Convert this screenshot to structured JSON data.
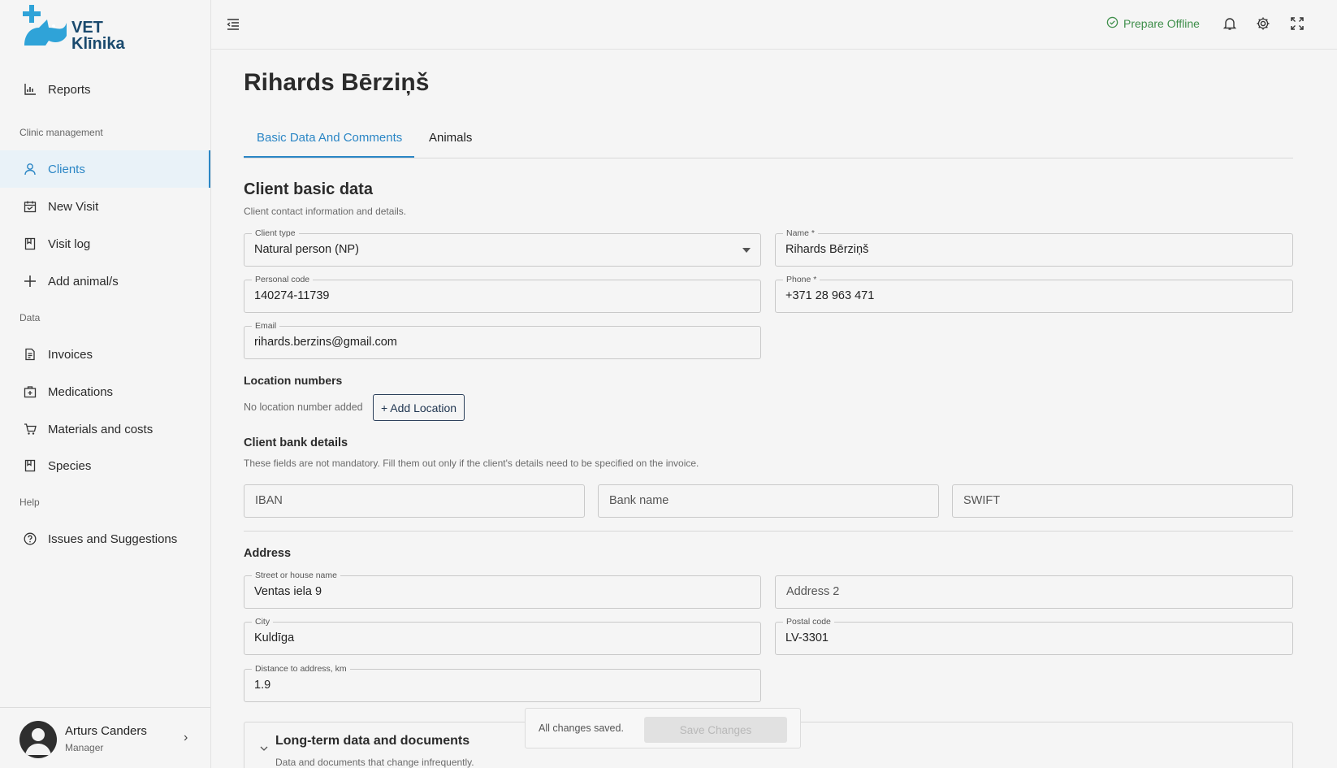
{
  "app": {
    "brand_line1": "VET",
    "brand_line2": "Klīnika"
  },
  "sidebar": {
    "top_item": {
      "label": "Reports",
      "icon": "bar-chart-icon"
    },
    "sections": [
      {
        "title": "Clinic management"
      },
      {
        "title": "Data"
      },
      {
        "title": "Help"
      }
    ],
    "items": [
      {
        "label": "Clients",
        "icon": "user-icon",
        "active": true
      },
      {
        "label": "New Visit",
        "icon": "calendar-icon"
      },
      {
        "label": "Visit log",
        "icon": "bookmark-icon"
      },
      {
        "label": "Add animal/s",
        "icon": "plus-icon"
      },
      {
        "label": "Invoices",
        "icon": "document-icon"
      },
      {
        "label": "Medications",
        "icon": "medkit-icon"
      },
      {
        "label": "Materials and costs",
        "icon": "cart-icon"
      },
      {
        "label": "Species",
        "icon": "bookmark-icon"
      },
      {
        "label": "Issues and Suggestions",
        "icon": "help-circle-icon"
      }
    ],
    "user": {
      "name": "Arturs Canders",
      "role": "Manager"
    }
  },
  "topbar": {
    "offline_label": "Prepare Offline"
  },
  "page": {
    "title": "Rihards Bērziņš",
    "tabs": [
      {
        "label": "Basic Data And Comments",
        "active": true
      },
      {
        "label": "Animals",
        "active": false
      }
    ]
  },
  "basic": {
    "heading": "Client basic data",
    "description": "Client contact information and details.",
    "client_type": {
      "label": "Client type",
      "value": "Natural person (NP)"
    },
    "name": {
      "label": "Name *",
      "value": "Rihards Bērziņš"
    },
    "personal_code": {
      "label": "Personal code",
      "value": "140274-11739"
    },
    "phone": {
      "label": "Phone *",
      "value": "+371 28 963 471"
    },
    "email": {
      "label": "Email",
      "value": "rihards.berzins@gmail.com"
    }
  },
  "location": {
    "heading": "Location numbers",
    "empty_text": "No location number added",
    "add_label": "+ Add Location"
  },
  "bank": {
    "heading": "Client bank details",
    "description": "These fields are not mandatory. Fill them out only if the client's details need to be specified on the invoice.",
    "iban_placeholder": "IBAN",
    "bank_name_placeholder": "Bank name",
    "swift_placeholder": "SWIFT"
  },
  "address": {
    "heading": "Address",
    "street": {
      "label": "Street or house name",
      "value": "Ventas iela 9"
    },
    "address2_placeholder": "Address 2",
    "city": {
      "label": "City",
      "value": "Kuldīga"
    },
    "postal": {
      "label": "Postal code",
      "value": "LV-3301"
    },
    "distance": {
      "label": "Distance to address, km",
      "value": "1.9"
    }
  },
  "longterm": {
    "title": "Long-term data and documents",
    "description": "Data and documents that change infrequently."
  },
  "savebar": {
    "status": "All changes saved.",
    "button": "Save Changes"
  },
  "colors": {
    "accent": "#2b86c5",
    "offline": "#3e8e4a",
    "brand": "#1a4a6e"
  }
}
